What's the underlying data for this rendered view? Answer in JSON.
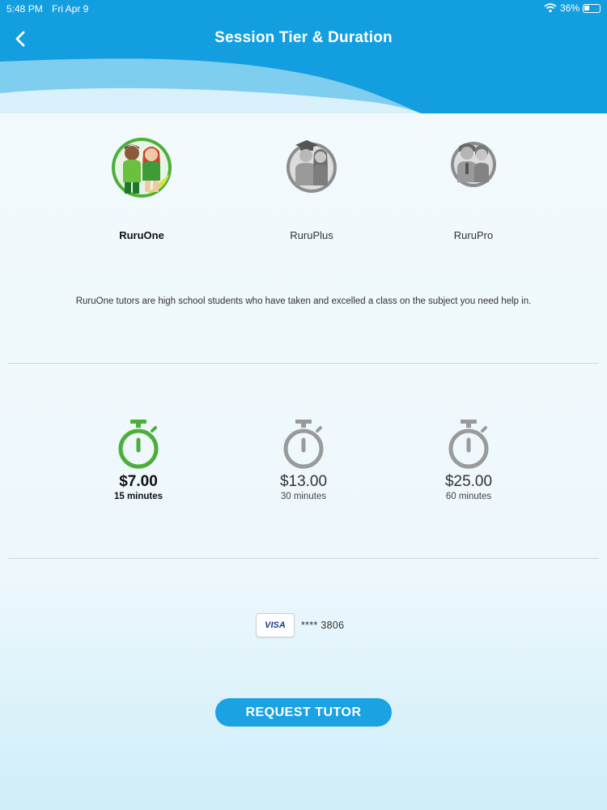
{
  "status_bar": {
    "time": "5:48 PM",
    "date": "Fri Apr 9",
    "battery": "36%",
    "battery_level": 0.36
  },
  "header": {
    "title": "Session Tier & Duration",
    "back_icon": "chevron-left-icon"
  },
  "tiers": [
    {
      "label": "RuruOne",
      "selected": true
    },
    {
      "label": "RuruPlus",
      "selected": false
    },
    {
      "label": "RuruPro",
      "selected": false
    }
  ],
  "tier_description": "RuruOne tutors are high school students who have taken and excelled a class on the subject you need help in.",
  "durations": [
    {
      "price": "$7.00",
      "minutes": "15 minutes",
      "selected": true
    },
    {
      "price": "$13.00",
      "minutes": "30 minutes",
      "selected": false
    },
    {
      "price": "$25.00",
      "minutes": "60 minutes",
      "selected": false
    }
  ],
  "payment": {
    "card_brand": "VISA",
    "card_number": "**** 3806"
  },
  "request_button": "REQUEST TUTOR",
  "colors": {
    "header_blue": "#139ee0",
    "selected_green": "#4caf3a",
    "unselected_gray": "#9a9a9a",
    "button_blue": "#1aa2e3"
  }
}
